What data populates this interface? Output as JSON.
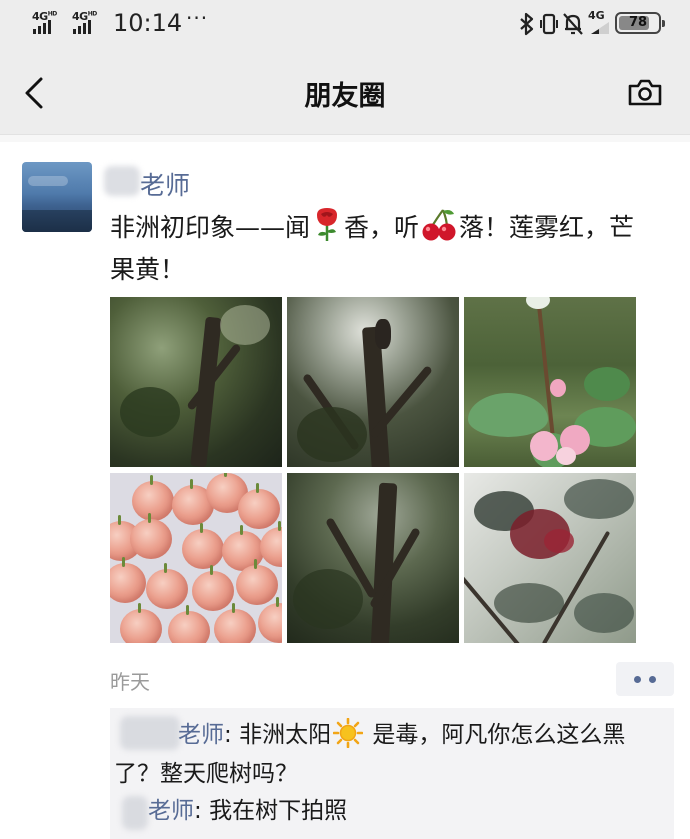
{
  "status_bar": {
    "network_1": "4G",
    "network_1_sup": "HD",
    "network_2": "4G",
    "network_2_sup": "HD",
    "time": "10:14",
    "more": "···",
    "network_3": "4G",
    "battery": "78",
    "icons": [
      "bluetooth-icon",
      "vibrate-icon",
      "mute-bell-icon",
      "signal-4g-icon",
      "battery-icon"
    ]
  },
  "nav": {
    "title": "朋友圈",
    "back_icon": "chevron-left-icon",
    "camera_icon": "camera-icon"
  },
  "post": {
    "author": "老师",
    "text_1": "非洲初印象——闻",
    "emoji_1": "rose-emoji",
    "text_2": "香，听",
    "emoji_2": "cherries-emoji",
    "text_3": "落！莲雾红，芒果黄！",
    "time": "昨天",
    "photos": [
      "tree-canopy-photo",
      "person-in-tree-photo",
      "wax-apple-branch-photo",
      "wax-apples-plate-photo",
      "tree-trunk-photo",
      "flowering-branches-photo"
    ]
  },
  "comments": [
    {
      "author": "老师",
      "sep": ": ",
      "text_1": "非洲太阳",
      "emoji": "sun-emoji",
      "text_2": " 是毒，阿凡你怎么这么黑了？整天爬树吗？"
    },
    {
      "author": "老师",
      "sep": ": ",
      "text_1": "我在树下拍照"
    }
  ],
  "colors": {
    "header_bg": "#ededed",
    "name_link": "#576b95",
    "comment_bg": "#f3f3f5",
    "timestamp": "#9a9a9a"
  }
}
